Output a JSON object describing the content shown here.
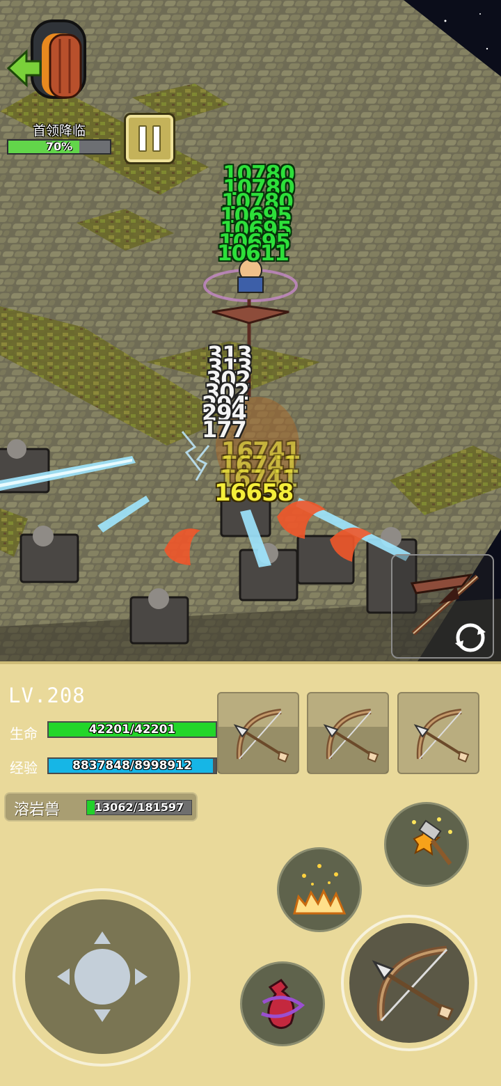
{
  "boss_event": {
    "label": "首领降临",
    "progress_text": "70%",
    "progress": 0.7
  },
  "damage_numbers": {
    "green_stack": [
      "10780",
      "10780",
      "10780",
      "10695",
      "10695",
      "10695",
      "10611"
    ],
    "white_stack": [
      "313",
      "313",
      "302",
      "302",
      "294",
      "294",
      "177"
    ],
    "yellow_main": "16658",
    "yellow_ghost": [
      "16741",
      "16741",
      "16741"
    ]
  },
  "player": {
    "level_text": "LV.208",
    "hp_label": "生命",
    "hp_text": "42201/42201",
    "hp_ratio": 1.0,
    "exp_label": "经验",
    "exp_text": "8837848/8998912",
    "exp_ratio": 0.982
  },
  "target_enemy": {
    "name": "溶岩兽",
    "hp_text": "13062/181597",
    "hp_ratio": 0.072
  },
  "weapon_slots": [
    {
      "icon": "bow-icon",
      "cooldown": 0.58
    },
    {
      "icon": "bow-icon",
      "cooldown": 0.58
    },
    {
      "icon": "bow-icon",
      "cooldown": 0.0
    }
  ],
  "skills": [
    "hammer-strike-icon",
    "burst-flames-icon",
    "potion-icon"
  ],
  "attack_icon": "bow-icon",
  "switch_weapon_icon": "crossbow-swap-icon",
  "colors": {
    "hp": "#23d62a",
    "exp": "#16b6e6",
    "panel": "#e9d99a",
    "boss_progress": "#62d64a"
  }
}
